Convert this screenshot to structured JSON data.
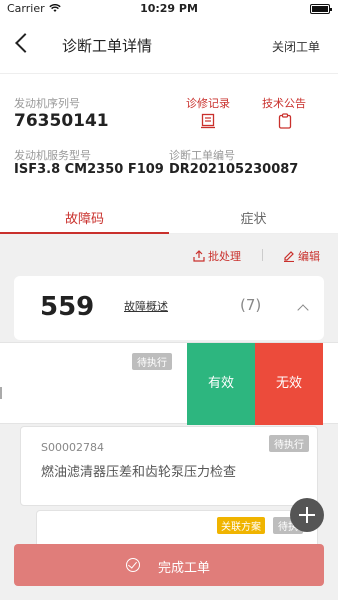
{
  "status_bar": {
    "carrier": "Carrier",
    "time": "10:29 PM"
  },
  "nav": {
    "title": "诊断工单详情",
    "close_label": "关闭工单"
  },
  "info": {
    "engine_serial_label": "发动机序列号",
    "engine_serial_value": "76350141",
    "engine_model_label": "发动机服务型号",
    "engine_model_value": "ISF3.8 CM2350 F109",
    "order_no_label": "诊断工单编号",
    "order_no_value": "DR202105230087",
    "repair_record_label": "诊修记录",
    "tech_notice_label": "技术公告"
  },
  "tabs": [
    {
      "label": "故障码"
    },
    {
      "label": "症状"
    }
  ],
  "toolbar": {
    "batch_label": "批处理",
    "edit_label": "编辑"
  },
  "fault_code": {
    "code": "559",
    "summary_link": "故障概述",
    "count": "(7)"
  },
  "swipe_row": {
    "status": "待执行",
    "valid_label": "有效",
    "invalid_label": "无效"
  },
  "task": {
    "id": "S00002784",
    "name": "燃油滤清器压差和齿轮泵压力检查",
    "status": "待执行"
  },
  "task2": {
    "tag": "关联方案",
    "status": "待执"
  },
  "footer": {
    "complete_label": "完成工单"
  },
  "colors": {
    "accent": "#c9302c",
    "valid": "#2db67f",
    "invalid": "#ec4b3b",
    "complete_bg": "#e07d7a"
  }
}
